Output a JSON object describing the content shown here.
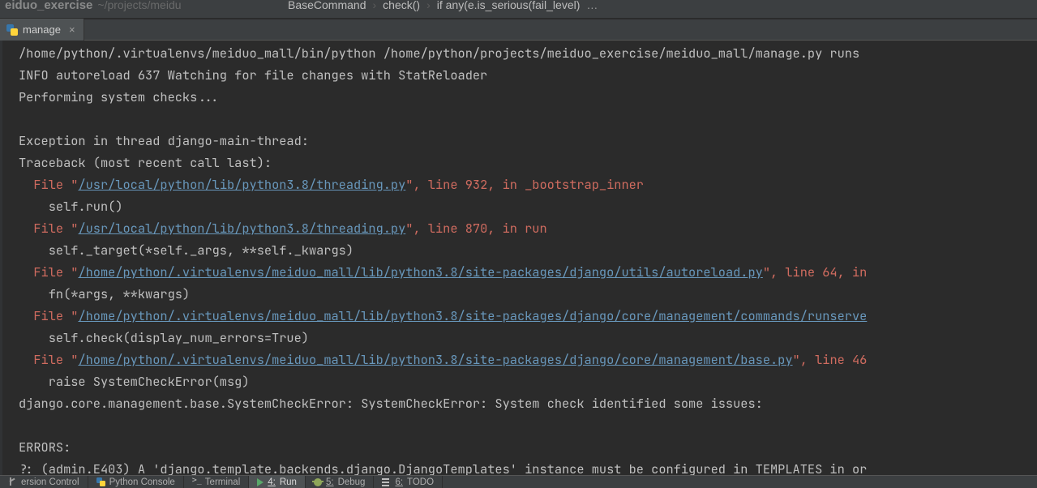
{
  "top": {
    "project_name": "eiduo_exercise",
    "project_path": "~/projects/meidu",
    "crumb1": "BaseCommand",
    "crumb2": "check()",
    "crumb3": "if any(e.is_serious(fail_level)",
    "ellipsis": "…"
  },
  "tab": {
    "label": "manage",
    "close": "×"
  },
  "console": {
    "lines": [
      {
        "cls": "grey",
        "text": "/home/python/.virtualenvs/meiduo_mall/bin/python /home/python/projects/meiduo_exercise/meiduo_mall/manage.py runs"
      },
      {
        "cls": "red",
        "text": "INFO autoreload 637 Watching for file changes with StatReloader"
      },
      {
        "cls": "grey",
        "text": "Performing system checks..."
      },
      {
        "cls": "grey",
        "text": ""
      },
      {
        "cls": "red",
        "text": "Exception in thread django-main-thread:"
      },
      {
        "cls": "red",
        "text": "Traceback (most recent call last):"
      },
      {
        "segments": [
          {
            "t": "  File \"",
            "c": "red"
          },
          {
            "t": "/usr/local/python/lib/python3.8/threading.py",
            "c": "link"
          },
          {
            "t": "\", line 932, in _bootstrap_inner",
            "c": "red"
          }
        ]
      },
      {
        "cls": "red",
        "text": "    self.run()"
      },
      {
        "segments": [
          {
            "t": "  File \"",
            "c": "red"
          },
          {
            "t": "/usr/local/python/lib/python3.8/threading.py",
            "c": "link"
          },
          {
            "t": "\", line 870, in run",
            "c": "red"
          }
        ]
      },
      {
        "cls": "red",
        "text": "    self._target(*self._args, **self._kwargs)"
      },
      {
        "segments": [
          {
            "t": "  File \"",
            "c": "red"
          },
          {
            "t": "/home/python/.virtualenvs/meiduo_mall/lib/python3.8/site-packages/django/utils/autoreload.py",
            "c": "link"
          },
          {
            "t": "\", line 64, in",
            "c": "red"
          }
        ]
      },
      {
        "cls": "red",
        "text": "    fn(*args, **kwargs)"
      },
      {
        "segments": [
          {
            "t": "  File \"",
            "c": "red"
          },
          {
            "t": "/home/python/.virtualenvs/meiduo_mall/lib/python3.8/site-packages/django/core/management/commands/runserve",
            "c": "link"
          }
        ]
      },
      {
        "cls": "red",
        "text": "    self.check(display_num_errors=True)"
      },
      {
        "segments": [
          {
            "t": "  File \"",
            "c": "red"
          },
          {
            "t": "/home/python/.virtualenvs/meiduo_mall/lib/python3.8/site-packages/django/core/management/base.py",
            "c": "link"
          },
          {
            "t": "\", line 46",
            "c": "red"
          }
        ]
      },
      {
        "cls": "red",
        "text": "    raise SystemCheckError(msg)"
      },
      {
        "cls": "red",
        "text": "django.core.management.base.SystemCheckError: SystemCheckError: System check identified some issues:"
      },
      {
        "cls": "red",
        "text": ""
      },
      {
        "cls": "red",
        "text": "ERRORS:"
      },
      {
        "cls": "red",
        "text": "?: (admin.E403) A 'django.template.backends.django.DjangoTemplates' instance must be configured in TEMPLATES in or"
      }
    ]
  },
  "bottom": {
    "vcs": "ersion Control",
    "pyconsole": "Python Console",
    "terminal": "Terminal",
    "run_pre": "4: ",
    "run_txt": "Run",
    "debug_pre": "5: ",
    "debug_txt": "Debug",
    "todo_pre": "6: ",
    "todo_txt": "TODO"
  }
}
